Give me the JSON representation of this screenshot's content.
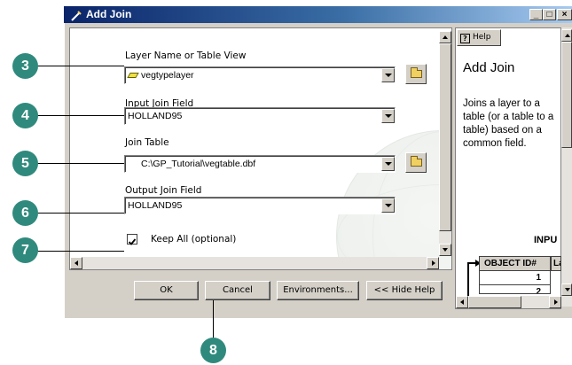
{
  "window": {
    "title": "Add Join"
  },
  "form": {
    "layer": {
      "label": "Layer Name or Table View",
      "value": "vegtypelayer"
    },
    "input_field": {
      "label": "Input Join Field",
      "value": "HOLLAND95"
    },
    "join_table": {
      "label": "Join Table",
      "value": "C:\\GP_Tutorial\\vegtable.dbf"
    },
    "output_field": {
      "label": "Output Join Field",
      "value": "HOLLAND95"
    },
    "keep_all": {
      "label": "Keep All (optional)",
      "checked": true
    }
  },
  "buttons": {
    "ok": "OK",
    "cancel": "Cancel",
    "environments": "Environments...",
    "hide_help": "<< Hide Help"
  },
  "help": {
    "tab_label": "Help",
    "title": "Add Join",
    "body": "Joins a layer to a table (or a table to a table) based on a common field.",
    "section": "INPU",
    "table": {
      "header": "OBJECT ID#",
      "header2": "La",
      "rows": [
        "1",
        "2"
      ]
    }
  },
  "callouts": [
    "3",
    "4",
    "5",
    "6",
    "7",
    "8"
  ],
  "colors": {
    "callout": "#2f8a7d",
    "titlebar": "#0a246a",
    "dialog": "#d4d0c8"
  }
}
